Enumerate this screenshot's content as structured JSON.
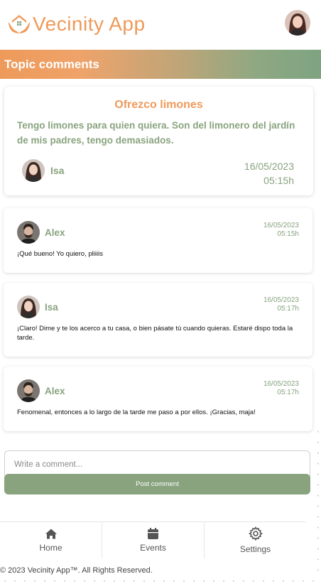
{
  "app": {
    "name": "Vecinity App",
    "brand_color": "#ee9a5a",
    "accent_color": "#88a37e"
  },
  "page_title": "Topic comments",
  "topic": {
    "title": "Ofrezco limones",
    "body": "Tengo limones para quien quiera. Son del limonero del jardín de mis padres, tengo demasiados.",
    "author": "Isa",
    "date": "16/05/2023",
    "time": "05:15h"
  },
  "comments": [
    {
      "author": "Alex",
      "date": "16/05/2023",
      "time": "05:15h",
      "text": "¡Qué bueno! Yo quiero, pliiiis"
    },
    {
      "author": "Isa",
      "date": "16/05/2023",
      "time": "05:17h",
      "text": "¡Claro! Dime y te los acerco a tu casa, o bien pásate tú cuando quieras. Estaré dispo toda la tarde."
    },
    {
      "author": "Alex",
      "date": "16/05/2023",
      "time": "05:17h",
      "text": "Fenomenal, entonces a lo largo de la tarde me paso a por ellos. ¡Gracias, maja!"
    }
  ],
  "comment_form": {
    "placeholder": "Write a comment...",
    "value": "",
    "submit_label": "Post comment"
  },
  "nav": [
    {
      "label": "Home",
      "icon": "home-icon"
    },
    {
      "label": "Events",
      "icon": "calendar-icon"
    },
    {
      "label": "Settings",
      "icon": "gear-icon"
    }
  ],
  "footer": "© 2023 Vecinity App™. All Rights Reserved."
}
